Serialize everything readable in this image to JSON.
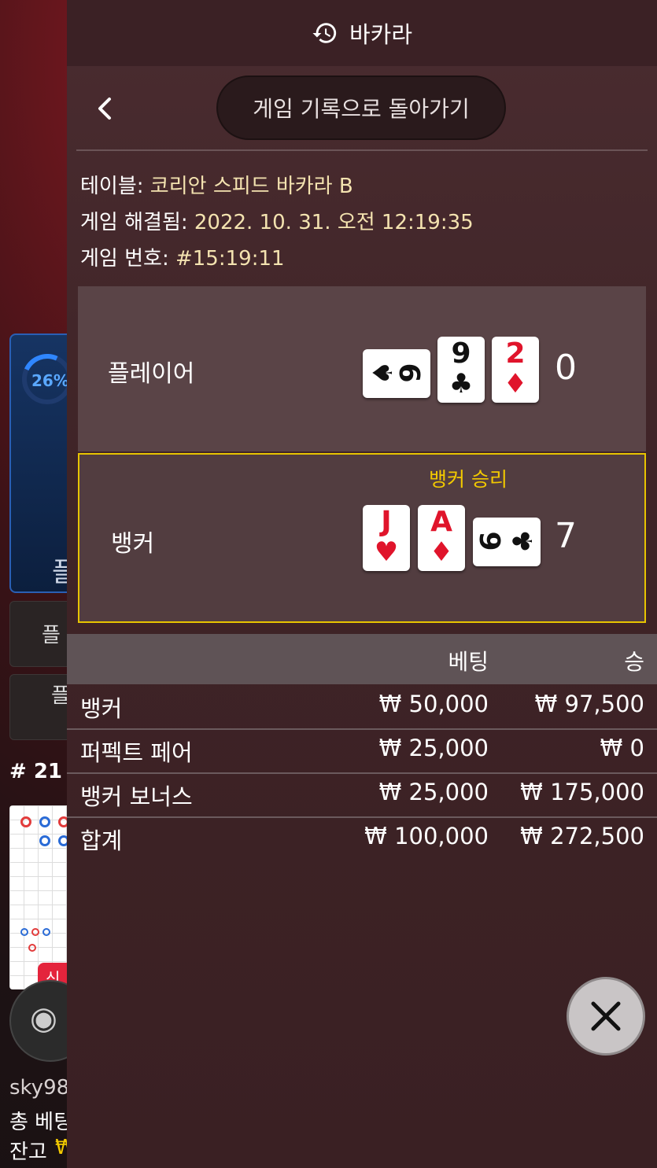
{
  "header": {
    "title": "바카라",
    "history_icon": "history-icon"
  },
  "nav": {
    "back_icon": "chevron-left-icon",
    "back_to_history": "게임 기록으로 돌아가기"
  },
  "info": {
    "table_label": "테이블: ",
    "table_value": "코리안 스피드 바카라 B",
    "resolved_label": "게임 해결됨: ",
    "resolved_value": "2022. 10. 31. 오전 12:19:35",
    "game_no_label": "게임 번호: ",
    "game_no_value": "#15:19:11"
  },
  "player": {
    "label": "플레이어",
    "score": "0",
    "cards": [
      {
        "rank": "9",
        "suit": "♠",
        "color": "black",
        "orientation": "horizontal"
      },
      {
        "rank": "9",
        "suit": "♣",
        "color": "black",
        "orientation": "vertical"
      },
      {
        "rank": "2",
        "suit": "♦",
        "color": "red",
        "orientation": "vertical"
      }
    ]
  },
  "banker": {
    "label": "뱅커",
    "score": "7",
    "result": "뱅커 승리",
    "highlight_color": "#e7c400",
    "cards": [
      {
        "rank": "J",
        "suit": "♥",
        "color": "red",
        "orientation": "vertical"
      },
      {
        "rank": "A",
        "suit": "♦",
        "color": "red",
        "orientation": "vertical"
      },
      {
        "rank": "6",
        "suit": "♣",
        "color": "black",
        "orientation": "horizontal"
      }
    ]
  },
  "bets_table": {
    "headers": {
      "bet": "베팅",
      "win": "승"
    },
    "rows": [
      {
        "name": "뱅커",
        "bet": "₩ 50,000",
        "win": "₩ 97,500"
      },
      {
        "name": "퍼펙트 페어",
        "bet": "₩ 25,000",
        "win": "₩ 0"
      },
      {
        "name": "뱅커 보너스",
        "bet": "₩ 25,000",
        "win": "₩ 175,000"
      },
      {
        "name": "합계",
        "bet": "₩ 100,000",
        "win": "₩ 272,500"
      }
    ]
  },
  "close_icon": "close-icon",
  "background": {
    "progress_label": "26%",
    "progress": 0.26,
    "bet_card_label": "플",
    "side_btn_1": "플",
    "side_btn_2": "플",
    "round": "# 21",
    "new_badge": "신",
    "username": "sky98",
    "total_bet_label": "총 베팅",
    "balance_label": "잔고",
    "balance_currency": "₩"
  }
}
